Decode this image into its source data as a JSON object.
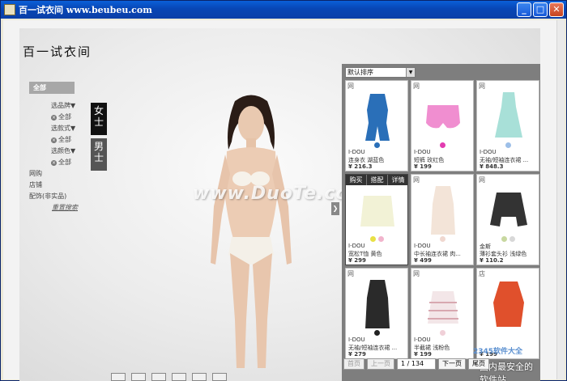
{
  "window": {
    "title": "百一试衣间 www.beubeu.com",
    "buttons": [
      "_",
      "□",
      "✕"
    ]
  },
  "app": {
    "logo": "百一试衣间"
  },
  "filters": {
    "all_label": "全部",
    "groups": [
      {
        "label": "选品牌▼",
        "all": "全部"
      },
      {
        "label": "选款式▼",
        "all": "全部"
      },
      {
        "label": "选颜色▼",
        "all": "全部"
      }
    ],
    "links": [
      "网购",
      "店铺",
      "配饰(非实品)"
    ],
    "reset": "重置搜索"
  },
  "gender": {
    "female": "女士",
    "male": "男士"
  },
  "watermark": "www.DuoTe.com",
  "sort": {
    "value": "默认排序"
  },
  "product_actions": [
    "购买",
    "搭配",
    "详情"
  ],
  "products": [
    {
      "tag": "网",
      "brand": "I-DOU",
      "name": "连身衣 湖蓝色",
      "price": "¥ 216.3",
      "colors": [
        "#2a6fb8"
      ]
    },
    {
      "tag": "网",
      "brand": "I-DOU",
      "name": "短裤 玫红色",
      "price": "¥ 199",
      "colors": [
        "#e23cb0"
      ]
    },
    {
      "tag": "网",
      "brand": "I-DOU",
      "name": "无袖/短袖连衣裙 ...",
      "price": "¥ 848.3",
      "colors": [
        "#9dbfe8"
      ]
    },
    {
      "tag": "",
      "brand": "I-DOU",
      "name": "宽松T恤 黄色",
      "price": "¥ 299",
      "colors": [
        "#e8e045",
        "#f1b4cc"
      ]
    },
    {
      "tag": "网",
      "brand": "I-DOU",
      "name": "中长袖连衣裙 肉...",
      "price": "¥ 499",
      "colors": [
        "#f0d8d0"
      ]
    },
    {
      "tag": "网",
      "brand": "金斯",
      "name": "薄衫套头衫 浅绿色",
      "price": "¥ 110.2",
      "colors": [
        "#c8d8a0",
        "#d8d8d8"
      ]
    },
    {
      "tag": "网",
      "brand": "I-DOU",
      "name": "无袖/短袖连衣裙 ...",
      "price": "¥ 279",
      "colors": [
        "#222222"
      ]
    },
    {
      "tag": "网",
      "brand": "I-DOU",
      "name": "半截裙 浅粉色",
      "price": "¥ 199",
      "colors": [
        "#f0d0d8"
      ]
    },
    {
      "tag": "店",
      "brand": "",
      "name": "",
      "price": "¥ 199",
      "colors": []
    }
  ],
  "pager": {
    "first": "首页",
    "prev": "上一页",
    "page": "1 / 134",
    "next": "下一页",
    "last": "尾页"
  },
  "corner_watermark": {
    "line1": "2345软件大全",
    "line2": "国内最安全的软件站"
  }
}
